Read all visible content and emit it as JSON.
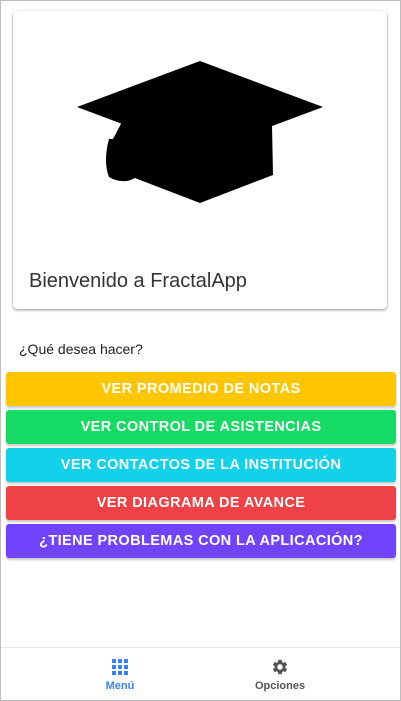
{
  "welcome_card": {
    "icon": "graduation-cap-icon",
    "title": "Bienvenido a FractalApp"
  },
  "prompt": "¿Qué desea hacer?",
  "actions": [
    {
      "label": "VER PROMEDIO DE NOTAS",
      "color": "#FFC600"
    },
    {
      "label": "VER CONTROL DE ASISTENCIAS",
      "color": "#15DA63"
    },
    {
      "label": "VER CONTACTOS DE LA INSTITUCIÓN",
      "color": "#11D2E8"
    },
    {
      "label": "VER DIAGRAMA DE AVANCE",
      "color": "#EF4246"
    },
    {
      "label": "¿TIENE PROBLEMAS CON LA APLICACIÓN?",
      "color": "#7044FF"
    }
  ],
  "bottom_nav": {
    "items": [
      {
        "label": "Menú",
        "icon": "grid-icon",
        "active": true,
        "color": "#3880FF"
      },
      {
        "label": "Opciones",
        "icon": "gear-icon",
        "active": false,
        "color": "#555555"
      }
    ]
  }
}
